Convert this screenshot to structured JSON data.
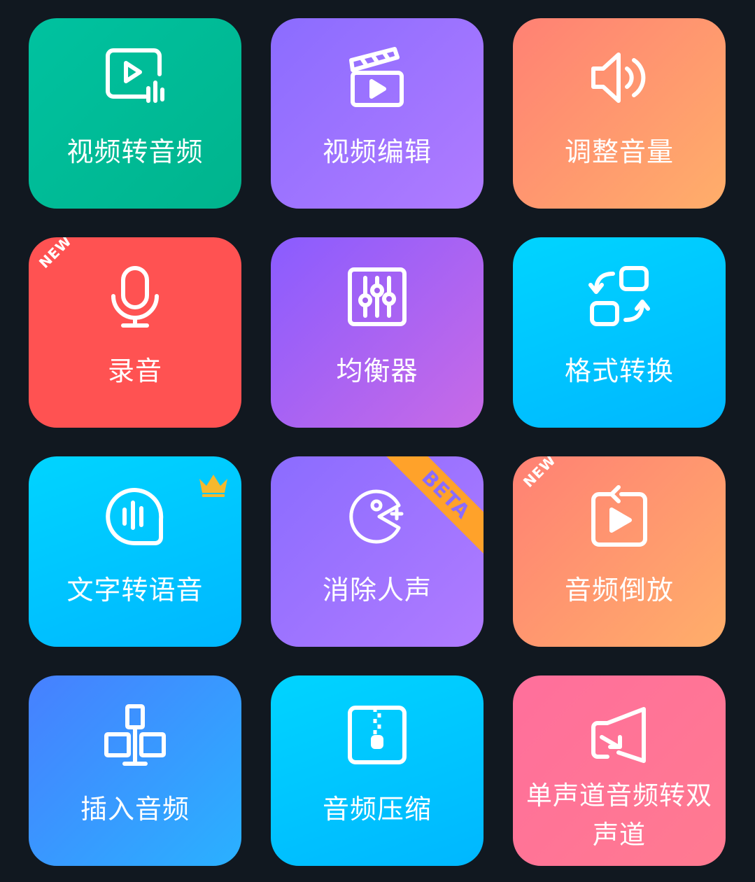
{
  "tiles": [
    {
      "label": "视频转音频",
      "icon": "video-to-audio-icon",
      "color": "#00c2a0"
    },
    {
      "label": "视频编辑",
      "icon": "clapperboard-icon",
      "color": "#9a72ff"
    },
    {
      "label": "调整音量",
      "icon": "speaker-volume-icon",
      "color": "#ff9870"
    },
    {
      "label": "录音",
      "icon": "microphone-icon",
      "color": "#ff5252",
      "badge": "NEW"
    },
    {
      "label": "均衡器",
      "icon": "equalizer-icon",
      "color": "#a462f0"
    },
    {
      "label": "格式转换",
      "icon": "format-convert-icon",
      "color": "#00c8ff"
    },
    {
      "label": "文字转语音",
      "icon": "text-to-speech-icon",
      "color": "#00c8ff",
      "premium_icon": "crown-icon",
      "premium_color": "#f5b82e"
    },
    {
      "label": "消除人声",
      "icon": "remove-vocals-icon",
      "color": "#9a72ff",
      "badge": "BETA",
      "badge_color": "#ffa22a"
    },
    {
      "label": "音频倒放",
      "icon": "reverse-audio-icon",
      "color": "#ff9870",
      "badge": "NEW"
    },
    {
      "label": "插入音频",
      "icon": "insert-audio-icon",
      "color": "#3a96ff"
    },
    {
      "label": "音频压缩",
      "icon": "zip-compress-icon",
      "color": "#00c8ff"
    },
    {
      "label": "单声道音频转双声道",
      "icon": "mono-to-stereo-icon",
      "color": "#ff7496"
    }
  ],
  "background": "#111820"
}
